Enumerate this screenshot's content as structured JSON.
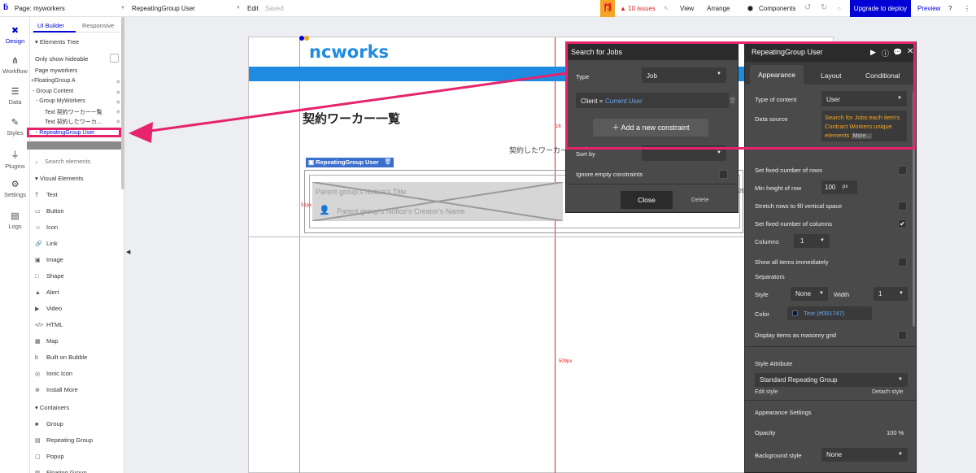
{
  "topbar": {
    "page_label": "Page: myworkers",
    "element_label": "RepeatingGroup User",
    "edit": "Edit",
    "saved": "Saved",
    "issues": "10 issues",
    "view": "View",
    "arrange": "Arrange",
    "components": "Components",
    "upgrade": "Upgrade to deploy",
    "preview": "Preview"
  },
  "rail": [
    "Design",
    "Workflow",
    "Data",
    "Styles",
    "Plugins",
    "Settings",
    "Logs"
  ],
  "panel": {
    "tab_builder": "UI Builder",
    "tab_responsive": "Responsive",
    "elements_tree": "Elements Tree",
    "only_hideable": "Only show hideable",
    "tree": [
      "Page myworkers",
      "+FloatingGroup A",
      "- Group Content",
      "- Group MyWorkers",
      "Text 契約ワーカー一覧",
      "Text 契約したワーカ...",
      "- RepeatingGroup User"
    ],
    "search_placeholder": "Search elements",
    "visual_header": "Visual Elements",
    "visual": [
      "Text",
      "Button",
      "Icon",
      "Link",
      "Image",
      "Shape",
      "Alert",
      "Video",
      "HTML",
      "Map",
      "Built on Bubble",
      "Ionic Icon",
      "Install More"
    ],
    "containers_header": "Containers",
    "containers": [
      "Group",
      "Repeating Group",
      "Popup",
      "Floating Group"
    ]
  },
  "canvas": {
    "logo": "ncworks",
    "heading": "契約ワーカー一覧",
    "subtext": "契約したワーカー",
    "rg_tag": "RepeatingGroup User",
    "cell_title": "Parent group's Notice's Title",
    "cell_creator": "Parent group's Notice's Creator's Name",
    "ruler_509": "509px",
    "ruler_51": "51px",
    "ruler_16": "16",
    "ruler_20": "20"
  },
  "search_popup": {
    "title": "Search for Jobs",
    "type_label": "Type",
    "type_value": "Job",
    "constraint_key": "Client =",
    "constraint_value": "Current User",
    "add_constraint": "Add a new constraint",
    "sort_by": "Sort by",
    "ignore_empty": "Ignore empty constraints",
    "close": "Close",
    "delete": "Delete"
  },
  "props": {
    "title": "RepeatingGroup User",
    "tabs": [
      "Appearance",
      "Layout",
      "Conditional"
    ],
    "type_of_content_label": "Type of content",
    "type_of_content_value": "User",
    "data_source_label": "Data source",
    "data_source_value": "Search for Jobs:each item's Contract Workers:unique elements",
    "data_source_more": "More...",
    "fixed_rows": "Set fixed number of rows",
    "min_height_label": "Min height of row",
    "min_height_value": "100",
    "min_height_unit": "px",
    "stretch_rows": "Stretch rows to fill vertical space",
    "fixed_cols": "Set fixed number of columns",
    "columns_label": "Columns",
    "columns_value": "1",
    "show_all": "Show all items immediately",
    "separators": "Separators",
    "style_label": "Style",
    "style_value": "None",
    "width_label": "Width",
    "width_value": "1",
    "color_label": "Color",
    "color_value": "Text (#091747)",
    "masonry": "Display items as masonry grid",
    "style_attr": "Style Attribute",
    "style_attr_value": "Standard Repeating Group",
    "edit_style": "Edit style",
    "detach_style": "Detach style",
    "appearance_settings": "Appearance Settings",
    "opacity_label": "Opacity",
    "opacity_value": "100 %",
    "bg_style_label": "Background style",
    "bg_style_value": "None"
  },
  "colors": {
    "pink": "#e6246c",
    "blue": "#0000d6",
    "bubble_blue": "#0205d3",
    "orange": "#f6a623",
    "red": "#e02424"
  }
}
